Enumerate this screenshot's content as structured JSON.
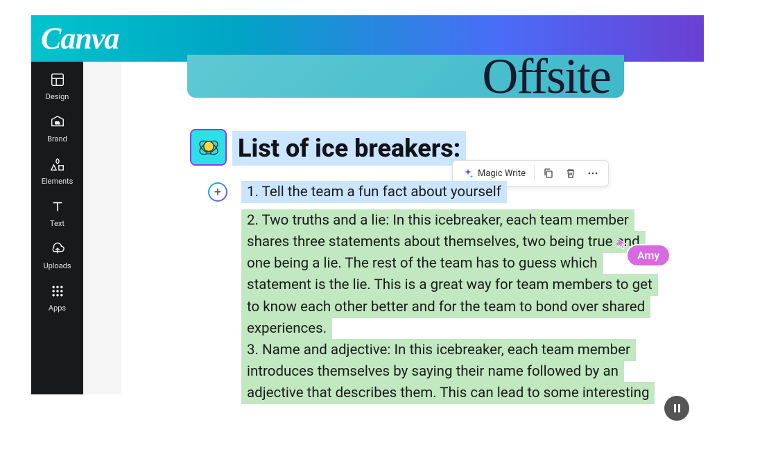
{
  "logo": "Canva",
  "sidebar": {
    "items": [
      {
        "label": "Design",
        "icon": "layout"
      },
      {
        "label": "Brand",
        "icon": "brand"
      },
      {
        "label": "Elements",
        "icon": "elements"
      },
      {
        "label": "Text",
        "icon": "text"
      },
      {
        "label": "Uploads",
        "icon": "cloud"
      },
      {
        "label": "Apps",
        "icon": "apps"
      }
    ]
  },
  "header": {
    "title_fragment": "Offsite"
  },
  "document": {
    "heading": "List of ice breakers:",
    "list": [
      "1.   Tell the team a fun fact about yourself",
      "2.  Two truths and a lie: In this icebreaker, each team member shares three statements about themselves, two being true and one being a lie. The rest of the team has to guess which statement is the lie.  This is a great way for team members to get to know each other better and for the team to bond over shared experiences.",
      "3.  Name and adjective: In this icebreaker, each team member introduces themselves by saying their name followed by an adjective that describes them. This can lead to some interesting"
    ]
  },
  "toolbar": {
    "magic_write": "Magic Write"
  },
  "collaborator": {
    "name": "Amy"
  }
}
